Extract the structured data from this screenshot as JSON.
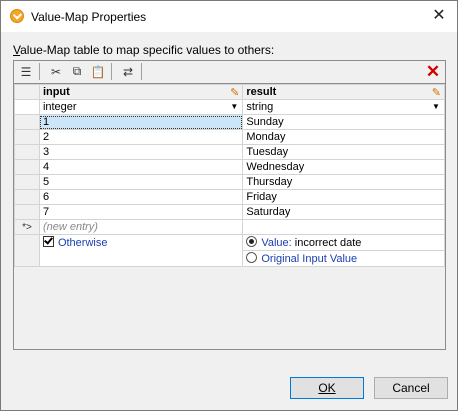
{
  "window": {
    "title": "Value-Map Properties"
  },
  "instruction": {
    "accel": "V",
    "rest": "alue-Map table to map specific values to others:"
  },
  "columns": [
    {
      "name": "input",
      "type": "integer"
    },
    {
      "name": "result",
      "type": "string"
    }
  ],
  "rows": [
    {
      "input": "1",
      "result": "Sunday"
    },
    {
      "input": "2",
      "result": "Monday"
    },
    {
      "input": "3",
      "result": "Tuesday"
    },
    {
      "input": "4",
      "result": "Wednesday"
    },
    {
      "input": "5",
      "result": "Thursday"
    },
    {
      "input": "6",
      "result": "Friday"
    },
    {
      "input": "7",
      "result": "Saturday"
    }
  ],
  "new_entry": {
    "marker": "*>",
    "placeholder": "(new entry)"
  },
  "otherwise": {
    "label": "Otherwise",
    "checked": true,
    "value_option": {
      "label": "Value:",
      "text": "incorrect date",
      "selected": true
    },
    "original_option": {
      "label": "Original Input Value",
      "selected": false
    }
  },
  "buttons": {
    "ok": "OK",
    "cancel": "Cancel"
  }
}
